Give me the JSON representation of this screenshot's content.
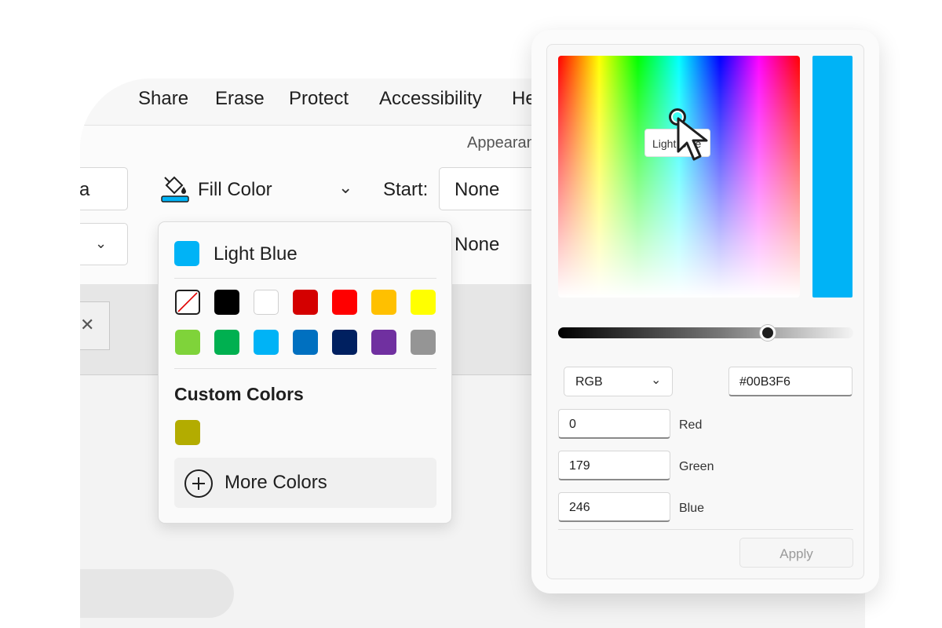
{
  "menu": {
    "items": [
      "Share",
      "Erase",
      "Protect",
      "Accessibility",
      "He"
    ]
  },
  "ribbon": {
    "group_label": "Appearan",
    "left_field_text": "a",
    "fill_color_label": "Fill Color",
    "start_label": "Start:",
    "start_value": "None",
    "end_value": "None"
  },
  "dropdown": {
    "selected": {
      "label": "Light Blue",
      "color": "#00B3F6"
    },
    "swatches": [
      {
        "name": "none",
        "color": "#ffffff"
      },
      {
        "name": "black",
        "color": "#000000"
      },
      {
        "name": "white",
        "color": "#ffffff"
      },
      {
        "name": "dark-red",
        "color": "#d40000"
      },
      {
        "name": "red",
        "color": "#ff0000"
      },
      {
        "name": "orange",
        "color": "#ffc000"
      },
      {
        "name": "yellow",
        "color": "#ffff00"
      },
      {
        "name": "light-green",
        "color": "#7fd33a"
      },
      {
        "name": "green",
        "color": "#00b050"
      },
      {
        "name": "light-blue",
        "color": "#00b3f6"
      },
      {
        "name": "blue",
        "color": "#0070c0"
      },
      {
        "name": "dark-blue",
        "color": "#002060"
      },
      {
        "name": "purple",
        "color": "#7030a0"
      },
      {
        "name": "gray",
        "color": "#959595"
      }
    ],
    "custom_title": "Custom Colors",
    "custom_swatches": [
      {
        "name": "olive",
        "color": "#b3ac00"
      }
    ],
    "more_colors_label": "More Colors"
  },
  "picker": {
    "tooltip": "Light Blue",
    "preview_color": "#00B3F6",
    "brightness_level": 0.71,
    "model": "RGB",
    "hex": "#00B3F6",
    "channels": [
      {
        "value": "0",
        "label": "Red"
      },
      {
        "value": "179",
        "label": "Green"
      },
      {
        "value": "246",
        "label": "Blue"
      }
    ],
    "apply_label": "Apply"
  }
}
